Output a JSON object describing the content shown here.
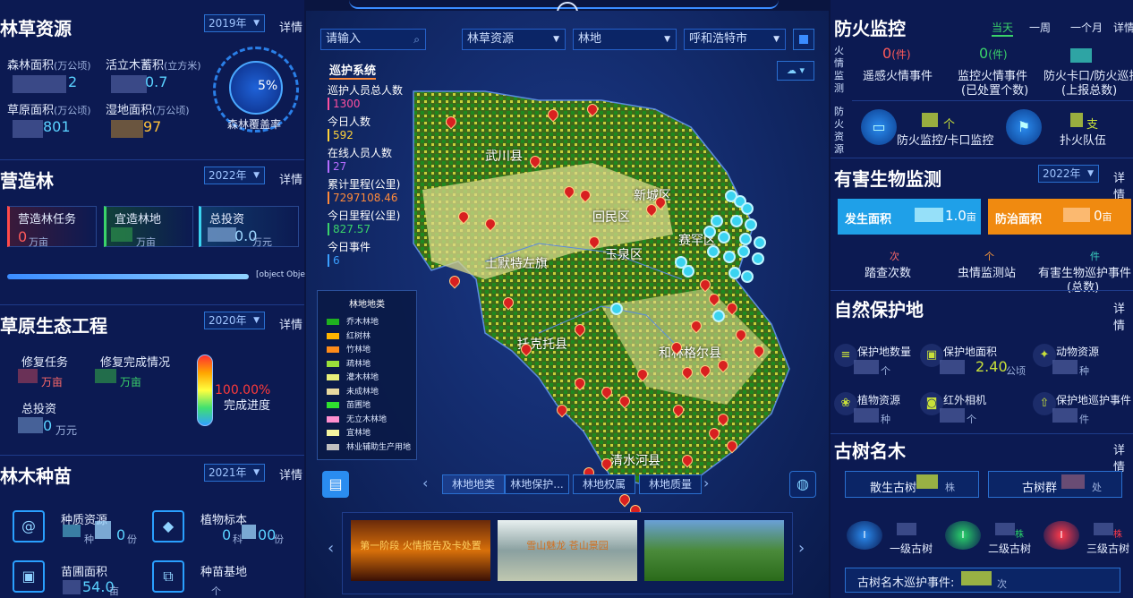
{
  "forest": {
    "title": "林草资源",
    "year": "2019年",
    "more": "详情",
    "forest_area": {
      "label": "森林面积",
      "unit": "(万公顷)",
      "value": "2"
    },
    "wood_stock": {
      "label": "活立木蓄积",
      "unit": "(立方米)",
      "value": "0.7"
    },
    "grass_area": {
      "label": "草原面积",
      "unit": "(万公顷)",
      "value": "801"
    },
    "wetland_area": {
      "label": "湿地面积",
      "unit": "(万公顷)",
      "value": "97"
    },
    "coverage": {
      "value": "5%",
      "label": "森林覆盖率"
    }
  },
  "afforest": {
    "title": "营造林",
    "year": "2022年",
    "more": "详情",
    "task": {
      "label": "营造林任务",
      "value": "0",
      "unit": "万亩"
    },
    "suitable": {
      "label": "宜造林地",
      "unit": "万亩"
    },
    "investment": {
      "label": "总投资",
      "value": "0.0",
      "unit": "万元"
    },
    "progress_text": "[object Obje"
  },
  "grassland": {
    "title": "草原生态工程",
    "year": "2020年",
    "more": "详情",
    "repair_task": {
      "label": "修复任务",
      "unit": "万亩"
    },
    "repair_done": {
      "label": "修复完成情况",
      "unit": "万亩"
    },
    "investment": {
      "label": "总投资",
      "value": "0",
      "unit": "万元"
    },
    "progress": {
      "value": "100.00%",
      "label": "完成进度",
      "fraction": 1.0
    }
  },
  "seedling": {
    "title": "林木种苗",
    "year": "2021年",
    "more": "详情",
    "germplasm": {
      "label": "种质资源",
      "u1": "种",
      "v2": "0",
      "u2": "份"
    },
    "specimen": {
      "label": "植物标本",
      "v1": "0",
      "u1": "科",
      "v2": "00",
      "u2": "份"
    },
    "nursery": {
      "label": "苗圃面积",
      "value": "54.0",
      "unit": "亩"
    },
    "base": {
      "label": "种苗基地",
      "unit": "个"
    }
  },
  "map": {
    "search_placeholder": "请输入",
    "filter1": "林草资源",
    "filter2": "林地",
    "filter3": "呼和浩特市",
    "patrol": {
      "title": "巡护系统",
      "items": [
        {
          "label": "巡护人员总人数",
          "value": "1300",
          "color": "#ff4fa0"
        },
        {
          "label": "今日人数",
          "value": "592",
          "color": "#ffd23a"
        },
        {
          "label": "在线人员人数",
          "value": "27",
          "color": "#b56cff"
        },
        {
          "label": "累计里程(公里)",
          "value": "7297108.46",
          "color": "#ff8a3a"
        },
        {
          "label": "今日里程(公里)",
          "value": "827.57",
          "color": "#3ad36a"
        },
        {
          "label": "今日事件",
          "value": "6",
          "color": "#3aa0ff"
        }
      ]
    },
    "legend": {
      "title": "林地地类",
      "items": [
        {
          "label": "乔木林地",
          "color": "#1fb01f"
        },
        {
          "label": "红树林",
          "color": "#ffb400"
        },
        {
          "label": "竹林地",
          "color": "#ff8c1a"
        },
        {
          "label": "疏林地",
          "color": "#9adf3a"
        },
        {
          "label": "灌木林地",
          "color": "#e8ef7a"
        },
        {
          "label": "未成林地",
          "color": "#e8d9a0"
        },
        {
          "label": "苗圃地",
          "color": "#2fe02f"
        },
        {
          "label": "无立木林地",
          "color": "#ff8fcf"
        },
        {
          "label": "宜林地",
          "color": "#f4f4a0"
        },
        {
          "label": "林业辅助生产用地",
          "color": "#c0c0c0"
        }
      ]
    },
    "regions": [
      "武川县",
      "新城区",
      "回民区",
      "玉泉区",
      "赛罕区",
      "土默特左旗",
      "托克托县",
      "和林格尔县",
      "清水河县"
    ],
    "tabs": [
      "林地地类",
      "林地保护...",
      "林地权属",
      "林地质量"
    ],
    "videos": [
      "第一阶段 火情报告及卡处置",
      "雪山魅龙 苍山景园",
      ""
    ]
  },
  "fire": {
    "title": "防火监控",
    "periods": [
      "当天",
      "一周",
      "一个月",
      "详情"
    ],
    "section1": "火情监测",
    "section2": "防火资源",
    "remote": {
      "value": "0",
      "unit": "(件)",
      "label": "遥感火情事件"
    },
    "monitor": {
      "value": "0",
      "unit": "(件)",
      "label": "监控火情事件",
      "sub": "(已处置个数)"
    },
    "checkpoint": {
      "label": "防火卡口/防火巡护",
      "sub": "(上报总数)"
    },
    "cam": {
      "unit": "个",
      "label": "防火监控/卡口监控"
    },
    "team": {
      "unit": "支",
      "label": "扑火队伍"
    }
  },
  "pest": {
    "title": "有害生物监测",
    "year": "2022年",
    "more": "详情",
    "occur": {
      "label": "发生面积",
      "value": "1.0",
      "unit": "亩"
    },
    "control": {
      "label": "防治面积",
      "value": "0",
      "unit": "亩"
    },
    "survey": {
      "unit": "次",
      "label": "踏查次数"
    },
    "station": {
      "unit": "个",
      "label": "虫情监测站"
    },
    "patrol": {
      "unit": "件",
      "label": "有害生物巡护事件",
      "sub": "(总数)"
    }
  },
  "nature": {
    "title": "自然保护地",
    "more": "详情",
    "items": [
      {
        "label": "保护地数量",
        "unit": "个"
      },
      {
        "label": "保护地面积",
        "value": "2.40",
        "unit": "公顷"
      },
      {
        "label": "动物资源",
        "unit": "种"
      },
      {
        "label": "植物资源",
        "unit": "种"
      },
      {
        "label": "红外相机",
        "unit": "个"
      },
      {
        "label": "保护地巡护事件",
        "unit": "件"
      }
    ]
  },
  "trees": {
    "title": "古树名木",
    "more": "详情",
    "scattered": {
      "label": "散生古树",
      "unit": "株"
    },
    "group": {
      "label": "古树群",
      "unit": "处"
    },
    "levels": [
      {
        "label": "一级古树"
      },
      {
        "label": "二级古树",
        "unit": "株"
      },
      {
        "label": "三级古树",
        "unit": "株"
      }
    ],
    "event": {
      "label": "古树名木巡护事件:",
      "unit": "次"
    }
  }
}
